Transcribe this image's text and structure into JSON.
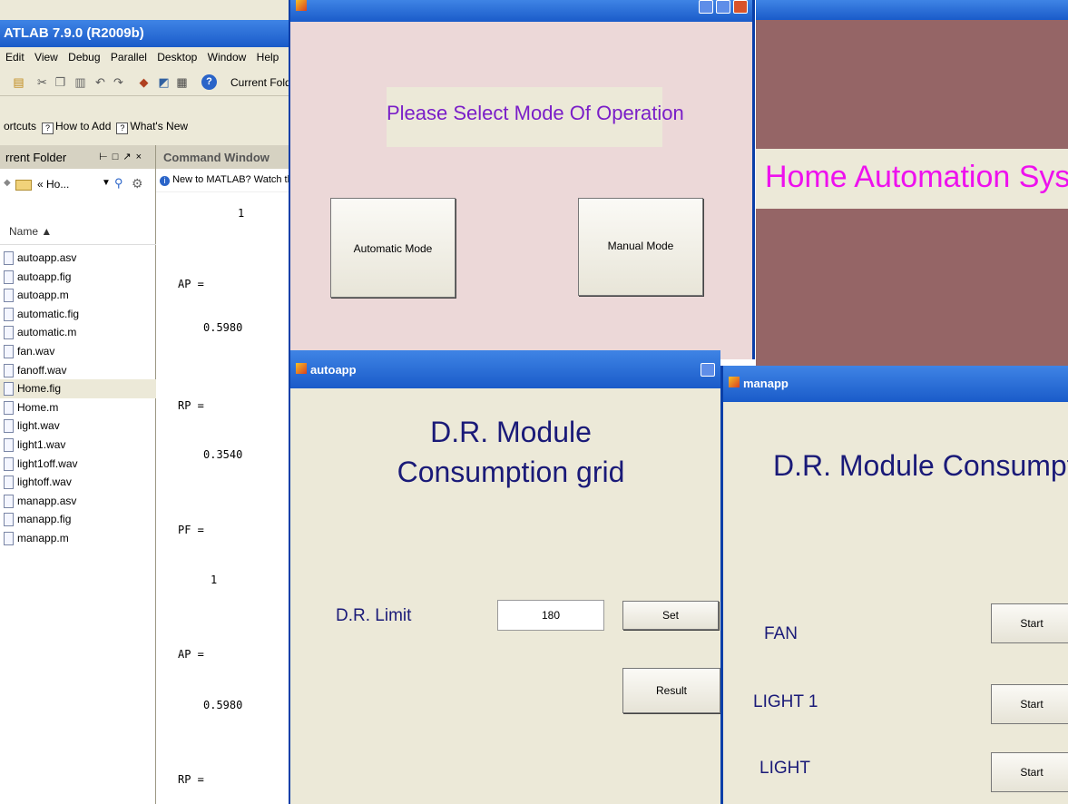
{
  "matlab": {
    "title": "ATLAB  7.9.0 (R2009b)",
    "menu": [
      "Edit",
      "View",
      "Debug",
      "Parallel",
      "Desktop",
      "Window",
      "Help"
    ],
    "toolbar_label": "Current Folder",
    "shortcuts": {
      "prefix": "ortcuts",
      "how_to_add": "How to Add",
      "whats_new": "What's New"
    },
    "current_folder": {
      "header": "rrent Folder",
      "path": "« Ho...",
      "name_column": "Name ▲",
      "files": [
        "autoapp.asv",
        "autoapp.fig",
        "autoapp.m",
        "automatic.fig",
        "automatic.m",
        "fan.wav",
        "fanoff.wav",
        "Home.fig",
        "Home.m",
        "light.wav",
        "light1.wav",
        "light1off.wav",
        "lightoff.wav",
        "manapp.asv",
        "manapp.fig",
        "manapp.m"
      ],
      "selected_index": 7
    },
    "command_window": {
      "header": "Command Window",
      "banner": "New to MATLAB? Watch this",
      "lines": [
        {
          "t": "1"
        },
        {
          "t": "AP ="
        },
        {
          "t": "0.5980"
        },
        {
          "t": "RP ="
        },
        {
          "t": "0.3540"
        },
        {
          "t": "PF ="
        },
        {
          "t": "1"
        },
        {
          "t": "AP ="
        },
        {
          "t": "0.5980"
        },
        {
          "t": "RP ="
        }
      ]
    }
  },
  "automatic": {
    "prompt": "Please Select Mode Of Operation",
    "automatic_button": "Automatic Mode",
    "manual_button": "Manual Mode"
  },
  "home": {
    "banner": "Home Automation System"
  },
  "autoapp": {
    "title": "autoapp",
    "heading_line1": "D.R. Module",
    "heading_line2": "Consumption grid",
    "dr_label": "D.R. Limit",
    "dr_value": "180",
    "set_button": "Set",
    "result_button": "Result"
  },
  "manapp": {
    "title": "manapp",
    "heading": "D.R. Module Consumptio",
    "devices": [
      {
        "label": "FAN",
        "button": "Start"
      },
      {
        "label": "LIGHT 1",
        "button": "Start"
      },
      {
        "label": "LIGHT",
        "button": "Start"
      }
    ]
  }
}
